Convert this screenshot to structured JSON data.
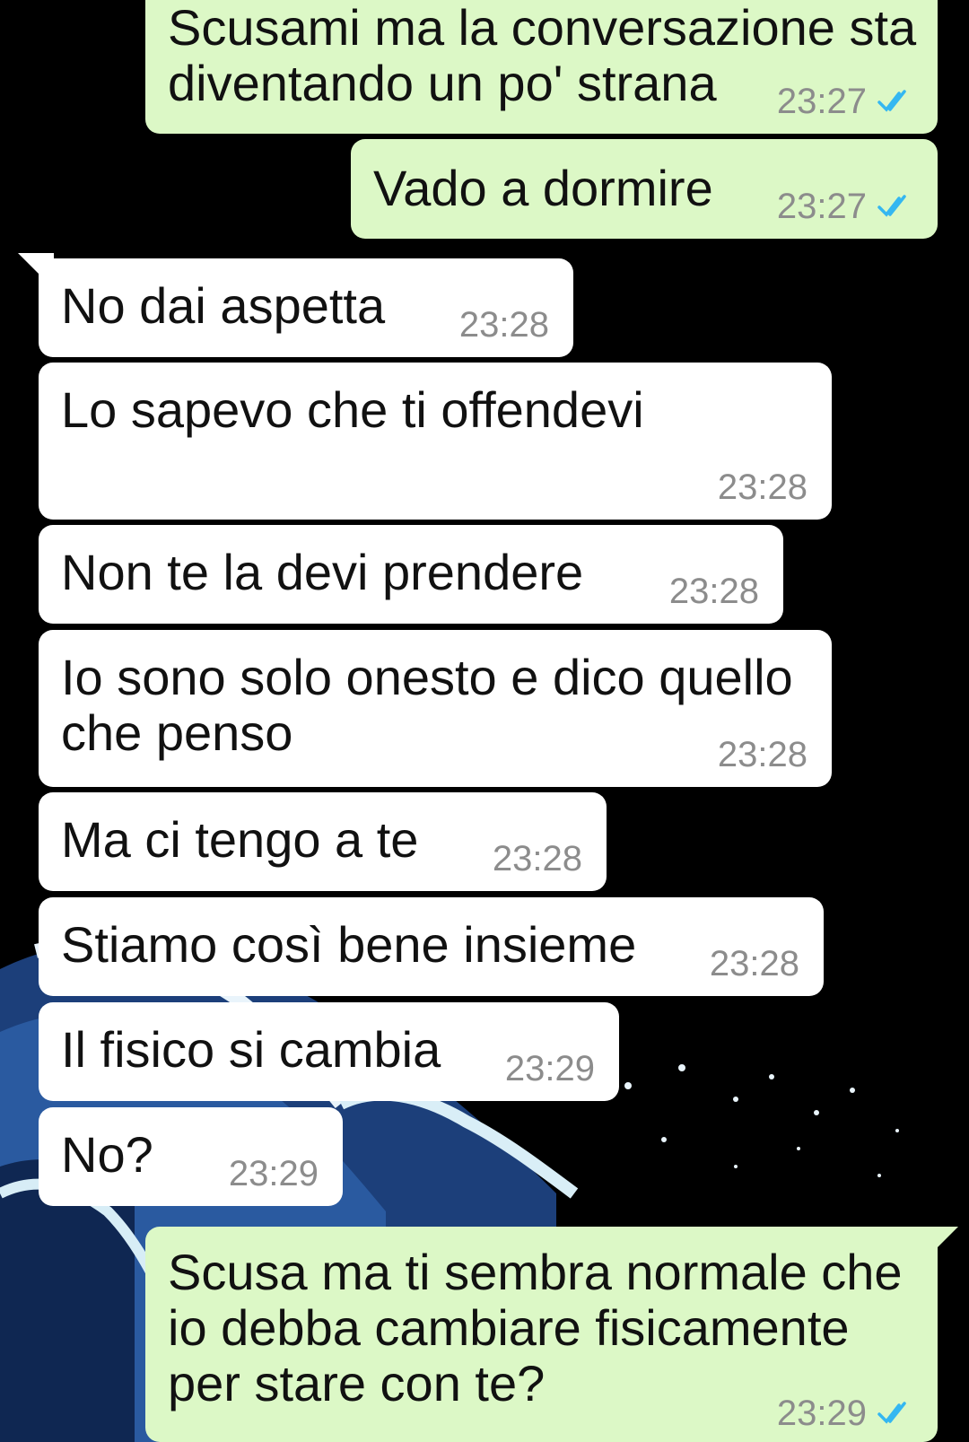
{
  "colors": {
    "incoming_bubble": "#ffffff",
    "outgoing_bubble": "#dcf8c6",
    "timestamp": "#8c8c8c",
    "read_ticks": "#34b7f1",
    "wallpaper_background": "#000000"
  },
  "wallpaper": {
    "icon": "great-wave-wallpaper"
  },
  "messages": [
    {
      "direction": "out",
      "lines": [
        "Scusami ma la conversazione sta",
        "diventando un po' strana"
      ],
      "time": "23:27",
      "status": "read"
    },
    {
      "direction": "out",
      "lines": [
        "Vado a dormire"
      ],
      "time": "23:27",
      "status": "read"
    },
    {
      "direction": "in",
      "lines": [
        "No dai aspetta"
      ],
      "time": "23:28"
    },
    {
      "direction": "in",
      "lines": [
        "Lo sapevo che ti offendevi"
      ],
      "time": "23:28"
    },
    {
      "direction": "in",
      "lines": [
        "Non te la devi prendere"
      ],
      "time": "23:28"
    },
    {
      "direction": "in",
      "lines": [
        "Io sono solo onesto e dico quello",
        "che penso"
      ],
      "time": "23:28"
    },
    {
      "direction": "in",
      "lines": [
        "Ma ci tengo a te"
      ],
      "time": "23:28"
    },
    {
      "direction": "in",
      "lines": [
        "Stiamo così bene insieme"
      ],
      "time": "23:28"
    },
    {
      "direction": "in",
      "lines": [
        "Il fisico si cambia"
      ],
      "time": "23:29"
    },
    {
      "direction": "in",
      "lines": [
        "No?"
      ],
      "time": "23:29"
    },
    {
      "direction": "out",
      "lines": [
        "Scusa ma ti sembra normale che",
        "io debba cambiare fisicamente",
        "per stare con te?"
      ],
      "time": "23:29",
      "status": "read"
    }
  ]
}
